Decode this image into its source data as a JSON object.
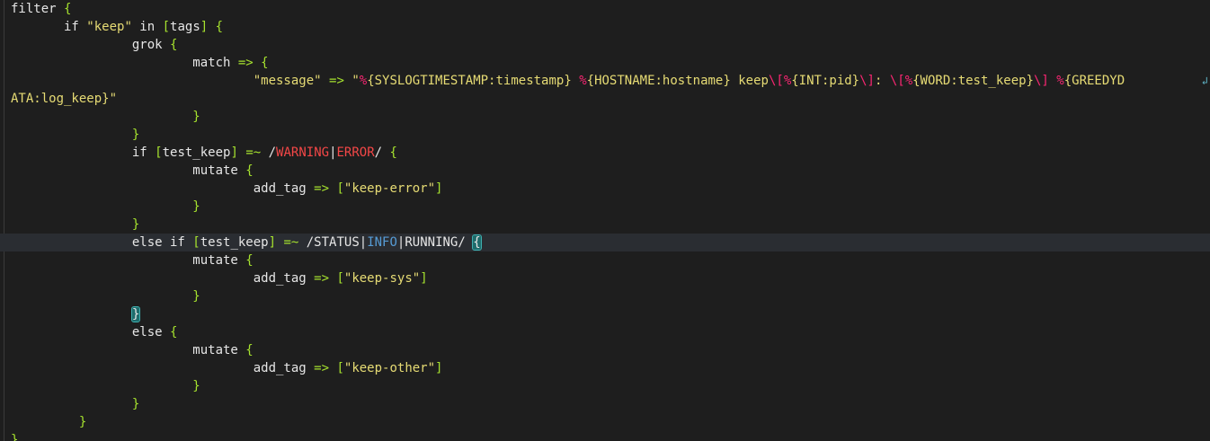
{
  "editor": {
    "lines": [
      {
        "segments": [
          [
            "filter ",
            "plain"
          ],
          [
            "{",
            "brace"
          ]
        ]
      },
      {
        "segments": [
          [
            "       if ",
            "plain"
          ],
          [
            "\"keep\"",
            "string"
          ],
          [
            " in ",
            "plain"
          ],
          [
            "[",
            "brace"
          ],
          [
            "tags",
            "plain"
          ],
          [
            "]",
            "brace"
          ],
          [
            " ",
            "plain"
          ],
          [
            "{",
            "brace"
          ]
        ]
      },
      {
        "segments": [
          [
            "                grok ",
            "plain"
          ],
          [
            "{",
            "brace"
          ]
        ]
      },
      {
        "segments": [
          [
            "                        match ",
            "plain"
          ],
          [
            "=>",
            "op"
          ],
          [
            " ",
            "plain"
          ],
          [
            "{",
            "brace"
          ]
        ]
      },
      {
        "wrap": true,
        "segments": [
          [
            "                                ",
            "plain"
          ],
          [
            "\"message\"",
            "string"
          ],
          [
            " ",
            "plain"
          ],
          [
            "=>",
            "op"
          ],
          [
            " ",
            "plain"
          ],
          [
            "\"",
            "string"
          ],
          [
            "%",
            "pct"
          ],
          [
            "{SYSLOGTIMESTAMP:timestamp}",
            "string"
          ],
          [
            " ",
            "string"
          ],
          [
            "%",
            "pct"
          ],
          [
            "{HOSTNAME:hostname}",
            "string"
          ],
          [
            " keep",
            "string"
          ],
          [
            "\\[",
            "esc"
          ],
          [
            "%",
            "pct"
          ],
          [
            "{INT:pid}",
            "string"
          ],
          [
            "\\]",
            "esc"
          ],
          [
            ": ",
            "string"
          ],
          [
            "\\[",
            "esc"
          ],
          [
            "%",
            "pct"
          ],
          [
            "{WORD:test_keep}",
            "string"
          ],
          [
            "\\]",
            "esc"
          ],
          [
            " ",
            "string"
          ],
          [
            "%",
            "pct"
          ],
          [
            "{GREEDYD",
            "string"
          ]
        ]
      },
      {
        "segments": [
          [
            "ATA:log_keep}\"",
            "string"
          ]
        ]
      },
      {
        "segments": [
          [
            "                        ",
            "plain"
          ],
          [
            "}",
            "brace"
          ]
        ]
      },
      {
        "segments": [
          [
            "                ",
            "plain"
          ],
          [
            "}",
            "brace"
          ]
        ]
      },
      {
        "segments": [
          [
            "                if ",
            "plain"
          ],
          [
            "[",
            "brace"
          ],
          [
            "test_keep",
            "plain"
          ],
          [
            "]",
            "brace"
          ],
          [
            " ",
            "plain"
          ],
          [
            "=~",
            "op"
          ],
          [
            " /",
            "plain"
          ],
          [
            "WARNING",
            "red"
          ],
          [
            "|",
            "plain"
          ],
          [
            "ERROR",
            "red"
          ],
          [
            "/ ",
            "plain"
          ],
          [
            "{",
            "brace"
          ]
        ]
      },
      {
        "segments": [
          [
            "                        mutate ",
            "plain"
          ],
          [
            "{",
            "brace"
          ]
        ]
      },
      {
        "segments": [
          [
            "                                add_tag ",
            "plain"
          ],
          [
            "=>",
            "op"
          ],
          [
            " ",
            "plain"
          ],
          [
            "[",
            "brace"
          ],
          [
            "\"keep-error\"",
            "string"
          ],
          [
            "]",
            "brace"
          ]
        ]
      },
      {
        "segments": [
          [
            "                        ",
            "plain"
          ],
          [
            "}",
            "brace"
          ]
        ]
      },
      {
        "segments": [
          [
            "                ",
            "plain"
          ],
          [
            "}",
            "brace"
          ]
        ]
      },
      {
        "current": true,
        "segments": [
          [
            "                else if ",
            "plain"
          ],
          [
            "[",
            "brace"
          ],
          [
            "test_keep",
            "plain"
          ],
          [
            "]",
            "brace"
          ],
          [
            " ",
            "plain"
          ],
          [
            "=~",
            "op"
          ],
          [
            " /STATUS",
            "plain"
          ],
          [
            "|",
            "plain"
          ],
          [
            "INFO",
            "blue"
          ],
          [
            "|",
            "plain"
          ],
          [
            "RUNNING/ ",
            "plain"
          ],
          [
            "{",
            "match"
          ]
        ]
      },
      {
        "segments": [
          [
            "                        mutate ",
            "plain"
          ],
          [
            "{",
            "brace"
          ]
        ]
      },
      {
        "segments": [
          [
            "                                add_tag ",
            "plain"
          ],
          [
            "=>",
            "op"
          ],
          [
            " ",
            "plain"
          ],
          [
            "[",
            "brace"
          ],
          [
            "\"keep-sys\"",
            "string"
          ],
          [
            "]",
            "brace"
          ]
        ]
      },
      {
        "segments": [
          [
            "                        ",
            "plain"
          ],
          [
            "}",
            "brace"
          ]
        ]
      },
      {
        "segments": [
          [
            "                ",
            "plain"
          ],
          [
            "}",
            "match"
          ]
        ]
      },
      {
        "segments": [
          [
            "                else ",
            "plain"
          ],
          [
            "{",
            "brace"
          ]
        ]
      },
      {
        "segments": [
          [
            "                        mutate ",
            "plain"
          ],
          [
            "{",
            "brace"
          ]
        ]
      },
      {
        "segments": [
          [
            "                                add_tag ",
            "plain"
          ],
          [
            "=>",
            "op"
          ],
          [
            " ",
            "plain"
          ],
          [
            "[",
            "brace"
          ],
          [
            "\"keep-other\"",
            "string"
          ],
          [
            "]",
            "brace"
          ]
        ]
      },
      {
        "segments": [
          [
            "                        ",
            "plain"
          ],
          [
            "}",
            "brace"
          ]
        ]
      },
      {
        "segments": [
          [
            "                ",
            "plain"
          ],
          [
            "}",
            "brace"
          ]
        ]
      },
      {
        "segments": [
          [
            "         ",
            "plain"
          ],
          [
            "}",
            "brace"
          ]
        ]
      },
      {
        "segments": [
          [
            "}",
            "brace"
          ]
        ]
      }
    ],
    "wrap_icon": "wrap-arrow-icon",
    "colors": {
      "background": "#1e1e1e",
      "text": "#e6e6e6",
      "brace": "#a6e22e",
      "string": "#e6db74",
      "format_specifier": "#f92672",
      "regex_red": "#f44747",
      "regex_blue": "#569cd6",
      "bracket_match": "#1f6b6b"
    }
  }
}
